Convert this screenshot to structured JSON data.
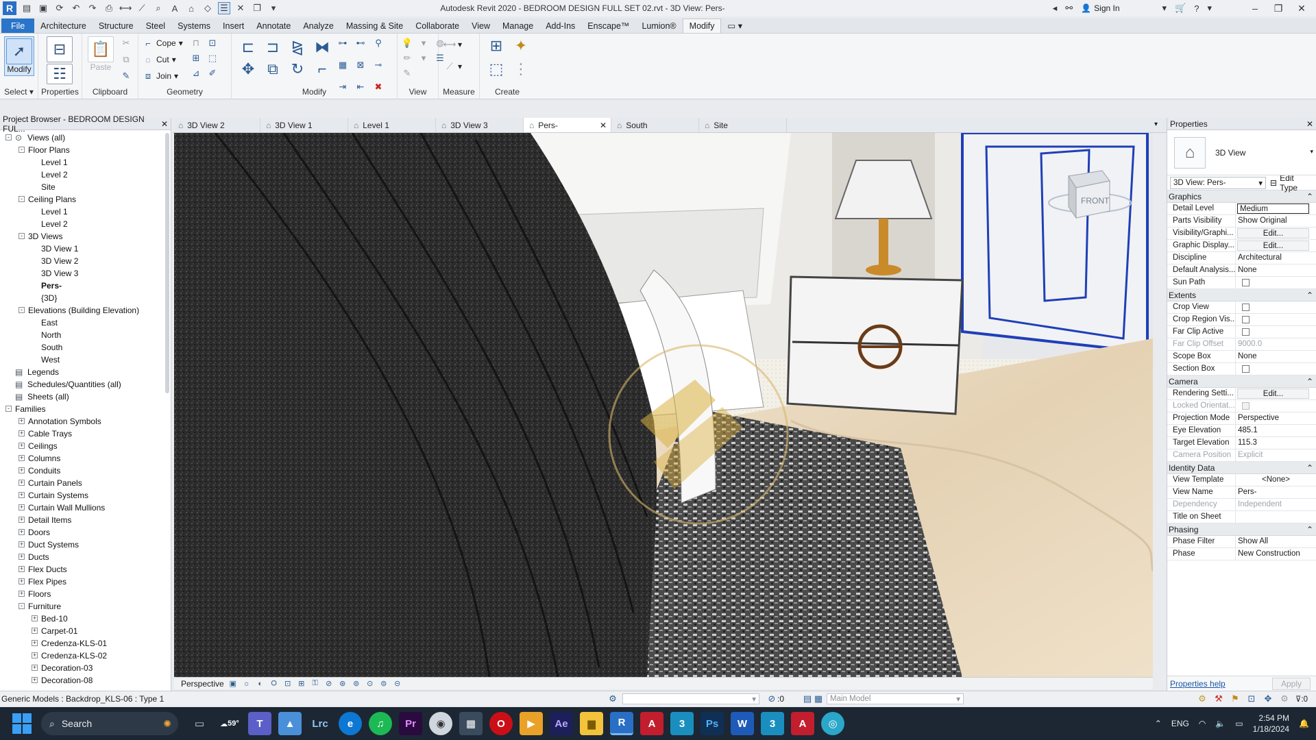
{
  "window": {
    "title": "Autodesk Revit 2020 - BEDROOM DESIGN FULL SET 02.rvt - 3D View: Pers-",
    "sign_in": "Sign In"
  },
  "ribbon_tabs": [
    "File",
    "Architecture",
    "Structure",
    "Steel",
    "Systems",
    "Insert",
    "Annotate",
    "Analyze",
    "Massing & Site",
    "Collaborate",
    "View",
    "Manage",
    "Add-Ins",
    "Enscape™",
    "Lumion®",
    "Modify"
  ],
  "ribbon": {
    "modify_label": "Modify",
    "select_label": "Select",
    "properties_label": "Properties",
    "paste_label": "Paste",
    "clipboard_label": "Clipboard",
    "cope_label": "Cope",
    "cut_label": "Cut",
    "join_label": "Join",
    "geometry_label": "Geometry",
    "modify_panel_label": "Modify",
    "view_label": "View",
    "measure_label": "Measure",
    "create_label": "Create"
  },
  "project_browser": {
    "title": "Project Browser - BEDROOM DESIGN FUL...",
    "items": [
      {
        "label": "Views (all)",
        "level": 0,
        "toggle": "-",
        "icon": "views"
      },
      {
        "label": "Floor Plans",
        "level": 1,
        "toggle": "-"
      },
      {
        "label": "Level 1",
        "level": 2
      },
      {
        "label": "Level 2",
        "level": 2
      },
      {
        "label": "Site",
        "level": 2
      },
      {
        "label": "Ceiling Plans",
        "level": 1,
        "toggle": "-"
      },
      {
        "label": "Level 1",
        "level": 2
      },
      {
        "label": "Level 2",
        "level": 2
      },
      {
        "label": "3D Views",
        "level": 1,
        "toggle": "-"
      },
      {
        "label": "3D View 1",
        "level": 2
      },
      {
        "label": "3D View 2",
        "level": 2
      },
      {
        "label": "3D View 3",
        "level": 2
      },
      {
        "label": "Pers-",
        "level": 2,
        "bold": true
      },
      {
        "label": "{3D}",
        "level": 2
      },
      {
        "label": "Elevations (Building Elevation)",
        "level": 1,
        "toggle": "-"
      },
      {
        "label": "East",
        "level": 2
      },
      {
        "label": "North",
        "level": 2
      },
      {
        "label": "South",
        "level": 2
      },
      {
        "label": "West",
        "level": 2
      },
      {
        "label": "Legends",
        "level": 0,
        "icon": "legend"
      },
      {
        "label": "Schedules/Quantities (all)",
        "level": 0,
        "icon": "schedule"
      },
      {
        "label": "Sheets (all)",
        "level": 0,
        "icon": "sheet"
      },
      {
        "label": "Families",
        "level": 0,
        "toggle": "-"
      },
      {
        "label": "Annotation Symbols",
        "level": 1,
        "toggle": "+"
      },
      {
        "label": "Cable Trays",
        "level": 1,
        "toggle": "+"
      },
      {
        "label": "Ceilings",
        "level": 1,
        "toggle": "+"
      },
      {
        "label": "Columns",
        "level": 1,
        "toggle": "+"
      },
      {
        "label": "Conduits",
        "level": 1,
        "toggle": "+"
      },
      {
        "label": "Curtain Panels",
        "level": 1,
        "toggle": "+"
      },
      {
        "label": "Curtain Systems",
        "level": 1,
        "toggle": "+"
      },
      {
        "label": "Curtain Wall Mullions",
        "level": 1,
        "toggle": "+"
      },
      {
        "label": "Detail Items",
        "level": 1,
        "toggle": "+"
      },
      {
        "label": "Doors",
        "level": 1,
        "toggle": "+"
      },
      {
        "label": "Duct Systems",
        "level": 1,
        "toggle": "+"
      },
      {
        "label": "Ducts",
        "level": 1,
        "toggle": "+"
      },
      {
        "label": "Flex Ducts",
        "level": 1,
        "toggle": "+"
      },
      {
        "label": "Flex Pipes",
        "level": 1,
        "toggle": "+"
      },
      {
        "label": "Floors",
        "level": 1,
        "toggle": "+"
      },
      {
        "label": "Furniture",
        "level": 1,
        "toggle": "-"
      },
      {
        "label": "Bed-10",
        "level": 2,
        "toggle": "+"
      },
      {
        "label": "Carpet-01",
        "level": 2,
        "toggle": "+"
      },
      {
        "label": "Credenza-KLS-01",
        "level": 2,
        "toggle": "+"
      },
      {
        "label": "Credenza-KLS-02",
        "level": 2,
        "toggle": "+"
      },
      {
        "label": "Decoration-03",
        "level": 2,
        "toggle": "+"
      },
      {
        "label": "Decoration-08",
        "level": 2,
        "toggle": "+"
      }
    ]
  },
  "view_tabs": [
    {
      "label": "3D View 2",
      "active": false
    },
    {
      "label": "3D View 1",
      "active": false
    },
    {
      "label": "Level 1",
      "active": false
    },
    {
      "label": "3D View 3",
      "active": false
    },
    {
      "label": "Pers-",
      "active": true
    },
    {
      "label": "South",
      "active": false
    },
    {
      "label": "Site",
      "active": false
    }
  ],
  "viewcube_label": "FRONT",
  "view_control_bar": {
    "projection": "Perspective"
  },
  "properties": {
    "title": "Properties",
    "type_name": "3D View",
    "instance_selector": "3D View: Pers-",
    "edit_type": "Edit Type",
    "sections": [
      {
        "name": "Graphics",
        "rows": [
          {
            "name": "Detail Level",
            "value": "Medium",
            "style": "boxed"
          },
          {
            "name": "Parts Visibility",
            "value": "Show Original"
          },
          {
            "name": "Visibility/Graphi...",
            "value": "Edit...",
            "style": "btn"
          },
          {
            "name": "Graphic Display...",
            "value": "Edit...",
            "style": "btn"
          },
          {
            "name": "Discipline",
            "value": "Architectural"
          },
          {
            "name": "Default Analysis...",
            "value": "None"
          },
          {
            "name": "Sun Path",
            "value": "",
            "style": "checkbox"
          }
        ]
      },
      {
        "name": "Extents",
        "rows": [
          {
            "name": "Crop View",
            "value": "",
            "style": "checkbox"
          },
          {
            "name": "Crop Region Vis...",
            "value": "",
            "style": "checkbox"
          },
          {
            "name": "Far Clip Active",
            "value": "",
            "style": "checkbox"
          },
          {
            "name": "Far Clip Offset",
            "value": "9000.0",
            "disabled": true
          },
          {
            "name": "Scope Box",
            "value": "None"
          },
          {
            "name": "Section Box",
            "value": "",
            "style": "checkbox"
          }
        ]
      },
      {
        "name": "Camera",
        "rows": [
          {
            "name": "Rendering Setti...",
            "value": "Edit...",
            "style": "btn"
          },
          {
            "name": "Locked Orientat...",
            "value": "",
            "style": "checkbox",
            "disabled": true
          },
          {
            "name": "Projection Mode",
            "value": "Perspective"
          },
          {
            "name": "Eye Elevation",
            "value": "485.1"
          },
          {
            "name": "Target Elevation",
            "value": "115.3"
          },
          {
            "name": "Camera Position",
            "value": "Explicit",
            "disabled": true
          }
        ]
      },
      {
        "name": "Identity Data",
        "rows": [
          {
            "name": "View Template",
            "value": "<None>",
            "style": "center"
          },
          {
            "name": "View Name",
            "value": "Pers-"
          },
          {
            "name": "Dependency",
            "value": "Independent",
            "disabled": true
          },
          {
            "name": "Title on Sheet",
            "value": ""
          }
        ]
      },
      {
        "name": "Phasing",
        "rows": [
          {
            "name": "Phase Filter",
            "value": "Show All"
          },
          {
            "name": "Phase",
            "value": "New Construction"
          }
        ]
      }
    ],
    "help_link": "Properties help",
    "apply": "Apply"
  },
  "status_bar": {
    "text": "Generic Models : Backdrop_KLS-06 : Type 1",
    "selection_count": ":0",
    "model": "Main Model",
    "filter_count": ":0"
  },
  "taskbar": {
    "search": "Search",
    "weather": "59°",
    "language": "ENG",
    "time": "2:54 PM",
    "date": "1/18/2024"
  },
  "colors": {
    "file_tab": "#2a75c9",
    "accent_blue": "#1a55a8",
    "taskbar": "#1c2733"
  }
}
